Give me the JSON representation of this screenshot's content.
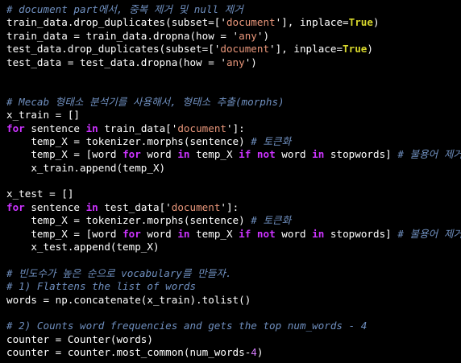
{
  "colors": {
    "background": "#000000",
    "default": "#ffffff",
    "comment": "#6f8fbf",
    "keyword": "#cc33ff",
    "string": "#e9967a",
    "bool": "#d6d62c",
    "number": "#d77cff"
  },
  "code": {
    "lines": [
      [
        {
          "t": "comment",
          "v": "# document part에서, 중복 제거 및 null 제거"
        }
      ],
      [
        {
          "t": "ident",
          "v": "train_data.drop_duplicates(subset=['"
        },
        {
          "t": "string",
          "v": "document"
        },
        {
          "t": "ident",
          "v": "'], inplace="
        },
        {
          "t": "bool",
          "v": "True"
        },
        {
          "t": "ident",
          "v": ")"
        }
      ],
      [
        {
          "t": "ident",
          "v": "train_data = train_data.dropna(how = '"
        },
        {
          "t": "string",
          "v": "any"
        },
        {
          "t": "ident",
          "v": "')"
        }
      ],
      [
        {
          "t": "ident",
          "v": "test_data.drop_duplicates(subset=['"
        },
        {
          "t": "string",
          "v": "document"
        },
        {
          "t": "ident",
          "v": "'], inplace="
        },
        {
          "t": "bool",
          "v": "True"
        },
        {
          "t": "ident",
          "v": ")"
        }
      ],
      [
        {
          "t": "ident",
          "v": "test_data = test_data.dropna(how = '"
        },
        {
          "t": "string",
          "v": "any"
        },
        {
          "t": "ident",
          "v": "')"
        }
      ],
      [],
      [],
      [
        {
          "t": "comment",
          "v": "# Mecab 형태소 분석기를 사용해서, 형태소 추출(morphs)"
        }
      ],
      [
        {
          "t": "ident",
          "v": "x_train = []"
        }
      ],
      [
        {
          "t": "keyword",
          "v": "for"
        },
        {
          "t": "ident",
          "v": " sentence "
        },
        {
          "t": "keyword",
          "v": "in"
        },
        {
          "t": "ident",
          "v": " train_data['"
        },
        {
          "t": "string",
          "v": "document"
        },
        {
          "t": "ident",
          "v": "']:"
        }
      ],
      [
        {
          "t": "ident",
          "v": "    temp_X = tokenizer.morphs(sentence) "
        },
        {
          "t": "comment",
          "v": "# 토큰화"
        }
      ],
      [
        {
          "t": "ident",
          "v": "    temp_X = [word "
        },
        {
          "t": "keyword",
          "v": "for"
        },
        {
          "t": "ident",
          "v": " word "
        },
        {
          "t": "keyword",
          "v": "in"
        },
        {
          "t": "ident",
          "v": " temp_X "
        },
        {
          "t": "keyword",
          "v": "if"
        },
        {
          "t": "ident",
          "v": " "
        },
        {
          "t": "keyword",
          "v": "not"
        },
        {
          "t": "ident",
          "v": " word "
        },
        {
          "t": "keyword",
          "v": "in"
        },
        {
          "t": "ident",
          "v": " stopwords] "
        },
        {
          "t": "comment",
          "v": "# 불용어 제거"
        }
      ],
      [
        {
          "t": "ident",
          "v": "    x_train.append(temp_X)"
        }
      ],
      [],
      [
        {
          "t": "ident",
          "v": "x_test = []"
        }
      ],
      [
        {
          "t": "keyword",
          "v": "for"
        },
        {
          "t": "ident",
          "v": " sentence "
        },
        {
          "t": "keyword",
          "v": "in"
        },
        {
          "t": "ident",
          "v": " test_data['"
        },
        {
          "t": "string",
          "v": "document"
        },
        {
          "t": "ident",
          "v": "']:"
        }
      ],
      [
        {
          "t": "ident",
          "v": "    temp_X = tokenizer.morphs(sentence) "
        },
        {
          "t": "comment",
          "v": "# 토큰화"
        }
      ],
      [
        {
          "t": "ident",
          "v": "    temp_X = [word "
        },
        {
          "t": "keyword",
          "v": "for"
        },
        {
          "t": "ident",
          "v": " word "
        },
        {
          "t": "keyword",
          "v": "in"
        },
        {
          "t": "ident",
          "v": " temp_X "
        },
        {
          "t": "keyword",
          "v": "if"
        },
        {
          "t": "ident",
          "v": " "
        },
        {
          "t": "keyword",
          "v": "not"
        },
        {
          "t": "ident",
          "v": " word "
        },
        {
          "t": "keyword",
          "v": "in"
        },
        {
          "t": "ident",
          "v": " stopwords] "
        },
        {
          "t": "comment",
          "v": "# 불용어 제거"
        }
      ],
      [
        {
          "t": "ident",
          "v": "    x_test.append(temp_X)"
        }
      ],
      [],
      [
        {
          "t": "comment",
          "v": "# 빈도수가 높은 순으로 vocabulary를 만들자."
        }
      ],
      [
        {
          "t": "comment",
          "v": "# 1) Flattens the list of words"
        }
      ],
      [
        {
          "t": "ident",
          "v": "words = np.concatenate(x_train).tolist()"
        }
      ],
      [],
      [
        {
          "t": "comment",
          "v": "# 2) Counts word frequencies and gets the top num_words - 4"
        }
      ],
      [
        {
          "t": "ident",
          "v": "counter = Counter(words)"
        }
      ],
      [
        {
          "t": "ident",
          "v": "counter = counter.most_common(num_words-"
        },
        {
          "t": "number",
          "v": "4"
        },
        {
          "t": "ident",
          "v": ")"
        }
      ]
    ]
  }
}
